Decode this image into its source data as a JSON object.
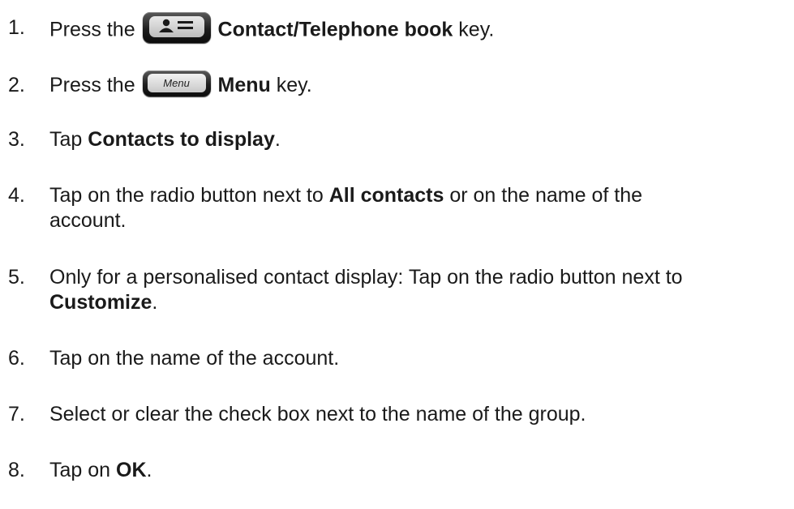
{
  "steps": [
    {
      "num": "1.",
      "pre": "Press the ",
      "bold": "Contact/Telephone book",
      "post": " key.",
      "key": "contact-book-key"
    },
    {
      "num": "2.",
      "pre": "Press the ",
      "bold": "Menu",
      "post": " key.",
      "key": "menu-key",
      "key_label": "Menu"
    },
    {
      "num": "3.",
      "pre": "Tap ",
      "bold": "Contacts to display",
      "post": "."
    },
    {
      "num": "4.",
      "pre": "Tap on the radio button next to ",
      "bold": "All contacts",
      "post": " or on the name of the",
      "line2": "account."
    },
    {
      "num": "5.",
      "pre": "Only for a personalised contact display: Tap on the radio button next to",
      "line2_bold": "Customize",
      "line2_post": "."
    },
    {
      "num": "6.",
      "pre": "Tap on the name of the account."
    },
    {
      "num": "7.",
      "pre": "Select or clear the check box next to the name of the group."
    },
    {
      "num": "8.",
      "pre": "Tap on ",
      "bold": "OK",
      "post": "."
    }
  ]
}
